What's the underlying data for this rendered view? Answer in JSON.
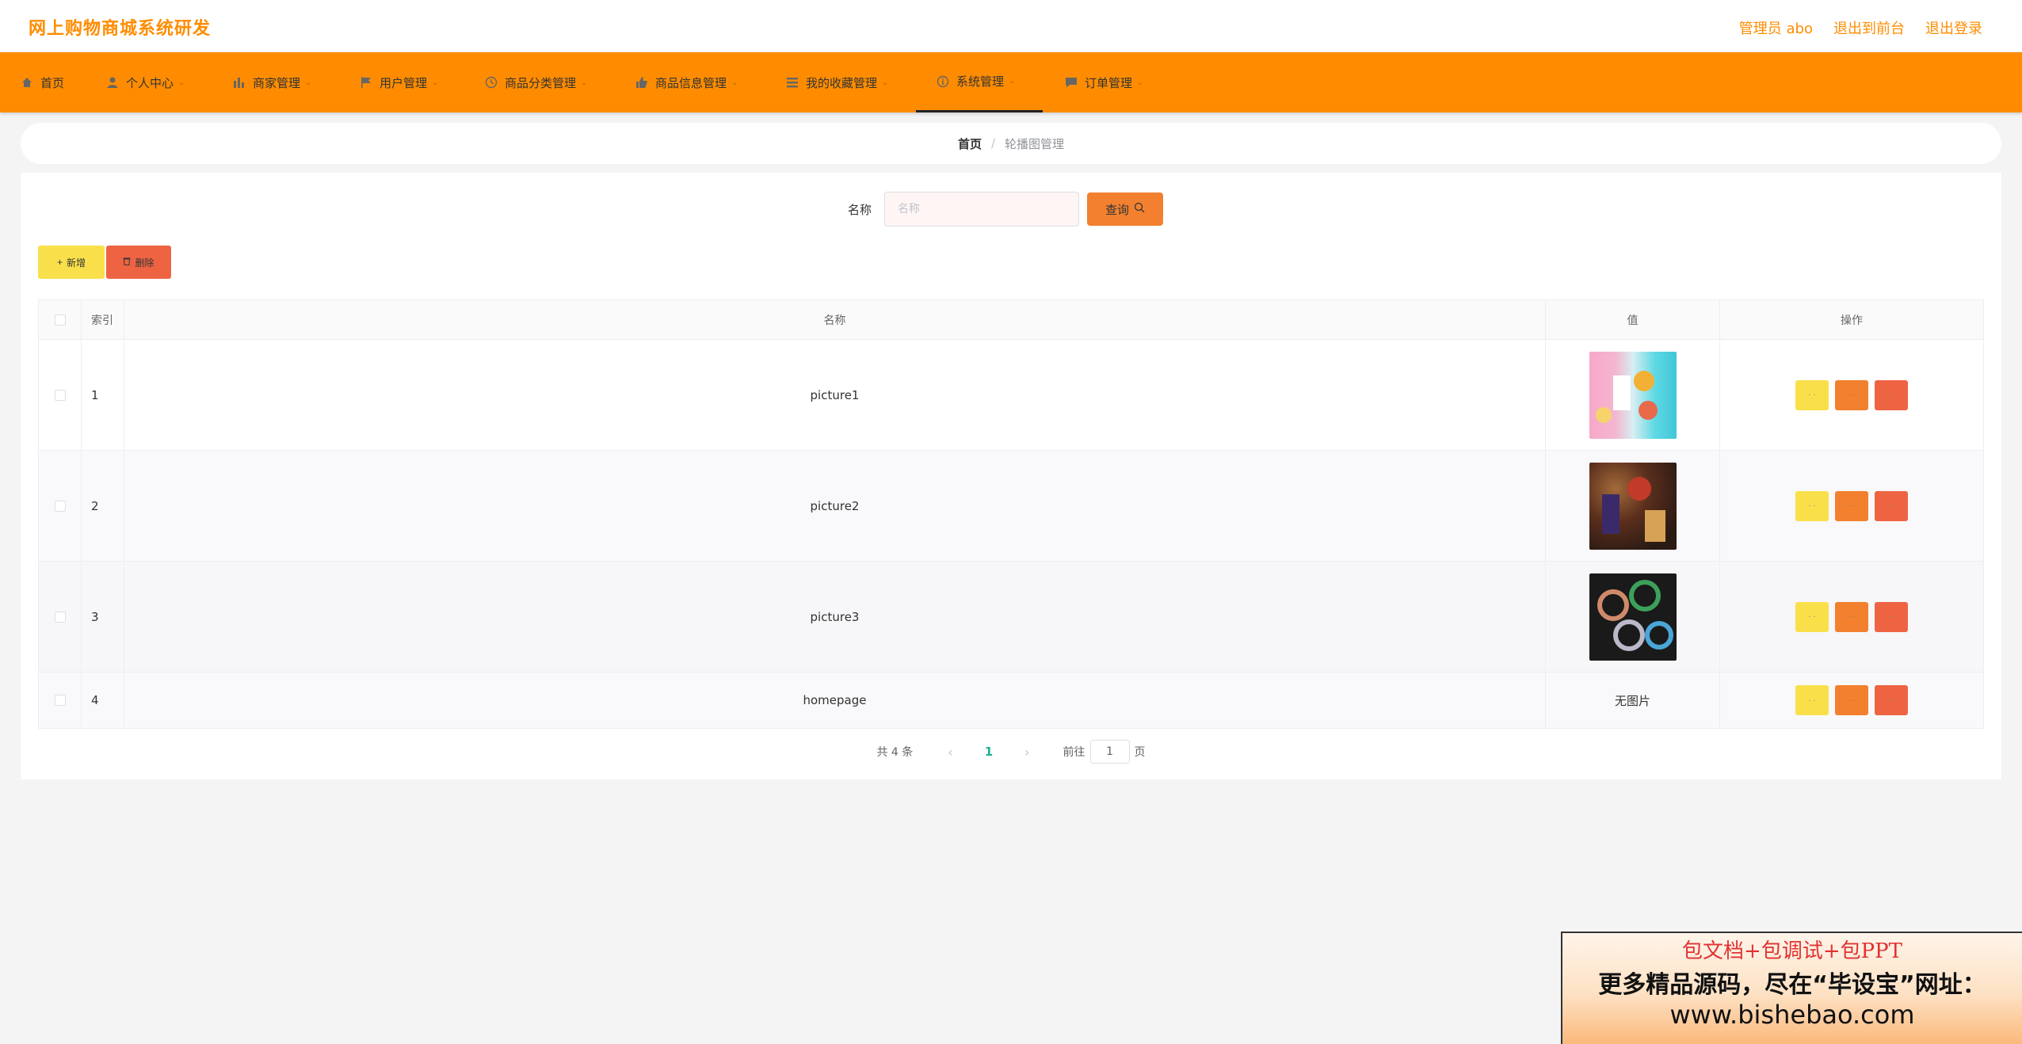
{
  "app": {
    "title": "网上购物商城系统研发",
    "admin_label": "管理员 abo",
    "to_frontend": "退出到前台",
    "logout": "退出登录"
  },
  "nav": [
    {
      "label": "首页",
      "icon": "home-icon"
    },
    {
      "label": "个人中心",
      "icon": "user-icon"
    },
    {
      "label": "商家管理",
      "icon": "chart-icon"
    },
    {
      "label": "用户管理",
      "icon": "flag-icon"
    },
    {
      "label": "商品分类管理",
      "icon": "clock-icon"
    },
    {
      "label": "商品信息管理",
      "icon": "thumb-icon"
    },
    {
      "label": "我的收藏管理",
      "icon": "list-icon"
    },
    {
      "label": "系统管理",
      "icon": "info-icon"
    },
    {
      "label": "订单管理",
      "icon": "chat-icon"
    }
  ],
  "breadcrumb": {
    "home": "首页",
    "separator": "/",
    "current": "轮播图管理"
  },
  "search": {
    "label": "名称",
    "placeholder": "名称",
    "value": "",
    "button": "查询"
  },
  "actions": {
    "add": "新增",
    "delete": "删除"
  },
  "table": {
    "headers": {
      "index": "索引",
      "name": "名称",
      "value": "值",
      "ops": "操作"
    },
    "rows": [
      {
        "index": "1",
        "name": "picture1",
        "image": "thumb-1"
      },
      {
        "index": "2",
        "name": "picture2",
        "image": "thumb-2"
      },
      {
        "index": "3",
        "name": "picture3",
        "image": "thumb-3"
      },
      {
        "index": "4",
        "name": "homepage",
        "no_image": "无图片"
      }
    ],
    "op_label": "· ·"
  },
  "pagination": {
    "total": "共 4 条",
    "page": "1",
    "goto_prefix": "前往",
    "goto_value": "1",
    "goto_suffix": "页"
  },
  "promo": {
    "line1": "包文档+包调试+包PPT",
    "line2": "更多精品源码，尽在“毕设宝”网址：",
    "line3": "www.bishebao.com"
  },
  "colors": {
    "brand": "#ff8c00",
    "add": "#f9e04b",
    "edit": "#f2802f",
    "delete": "#ee6443",
    "page_active": "#1ab394"
  }
}
